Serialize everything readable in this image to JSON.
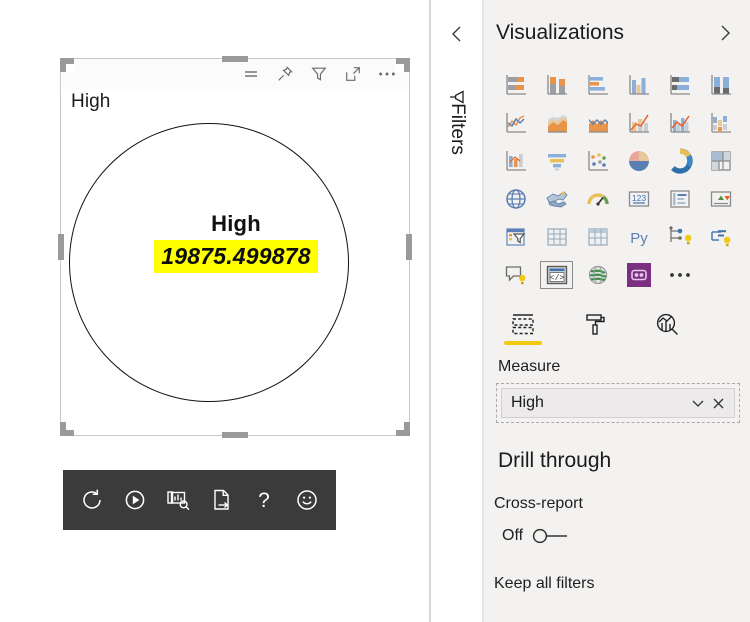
{
  "canvas": {
    "visual": {
      "title": "High",
      "category_label": "High",
      "value": "19875.499878",
      "highlight_color": "#FFFF00",
      "header_icons": [
        {
          "name": "drill-mode-icon",
          "label": "Drill mode"
        },
        {
          "name": "pin-icon",
          "label": "Pin visual"
        },
        {
          "name": "filter-icon",
          "label": "Filters"
        },
        {
          "name": "focus-mode-icon",
          "label": "Focus mode"
        },
        {
          "name": "more-options-icon",
          "label": "More options"
        }
      ]
    },
    "floating_toolbar": [
      {
        "name": "reset-icon",
        "label": "Reset"
      },
      {
        "name": "play-icon",
        "label": "Play"
      },
      {
        "name": "visual-search-icon",
        "label": "Analyze visual"
      },
      {
        "name": "export-file-icon",
        "label": "Export data"
      },
      {
        "name": "help-icon",
        "label": "Help"
      },
      {
        "name": "feedback-smiley-icon",
        "label": "Send feedback"
      }
    ]
  },
  "filters_rail": {
    "collapse_label": "Collapse",
    "title": "Filters"
  },
  "visualizations": {
    "title": "Visualizations",
    "expand_label": "Expand",
    "gallery": [
      {
        "name": "stacked-bar-chart-icon",
        "label": "Stacked bar chart"
      },
      {
        "name": "stacked-column-chart-icon",
        "label": "Stacked column chart"
      },
      {
        "name": "clustered-bar-chart-icon",
        "label": "Clustered bar chart"
      },
      {
        "name": "clustered-column-chart-icon",
        "label": "Clustered column chart"
      },
      {
        "name": "hundred-percent-stacked-bar-chart-icon",
        "label": "100% stacked bar chart"
      },
      {
        "name": "hundred-percent-stacked-column-chart-icon",
        "label": "100% stacked column chart"
      },
      {
        "name": "line-chart-icon",
        "label": "Line chart"
      },
      {
        "name": "area-chart-icon",
        "label": "Area chart"
      },
      {
        "name": "stacked-area-chart-icon",
        "label": "Stacked area chart"
      },
      {
        "name": "line-stacked-column-chart-icon",
        "label": "Line and stacked column chart"
      },
      {
        "name": "line-clustered-column-chart-icon",
        "label": "Line and clustered column chart"
      },
      {
        "name": "ribbon-waterfall-chart-icon",
        "label": "Waterfall chart"
      },
      {
        "name": "ribbon-chart-icon",
        "label": "Ribbon chart"
      },
      {
        "name": "funnel-chart-icon",
        "label": "Funnel"
      },
      {
        "name": "scatter-chart-icon",
        "label": "Scatter chart"
      },
      {
        "name": "pie-chart-icon",
        "label": "Pie chart"
      },
      {
        "name": "donut-chart-icon",
        "label": "Donut chart"
      },
      {
        "name": "treemap-icon",
        "label": "Treemap"
      },
      {
        "name": "map-icon",
        "label": "Map"
      },
      {
        "name": "filled-map-icon",
        "label": "Filled map"
      },
      {
        "name": "gauge-icon",
        "label": "Gauge"
      },
      {
        "name": "card-icon",
        "label": "Card"
      },
      {
        "name": "multi-row-card-icon",
        "label": "Multi-row card"
      },
      {
        "name": "kpi-icon",
        "label": "KPI"
      },
      {
        "name": "slicer-icon",
        "label": "Slicer"
      },
      {
        "name": "table-icon",
        "label": "Table"
      },
      {
        "name": "matrix-icon",
        "label": "Matrix"
      },
      {
        "name": "python-visual-icon",
        "label": "Py"
      },
      {
        "name": "decomposition-tree-icon",
        "label": "Decomposition tree"
      },
      {
        "name": "key-influencers-icon",
        "label": "Key influencers"
      },
      {
        "name": "qna-visual-icon",
        "label": "Q&A"
      },
      {
        "name": "custom-visual-code-icon",
        "label": "Custom visual"
      },
      {
        "name": "arcgis-maps-icon",
        "label": "ArcGIS Maps"
      },
      {
        "name": "power-apps-visual-icon",
        "label": "Power Apps"
      },
      {
        "name": "more-visuals-icon",
        "label": "More visuals"
      }
    ],
    "selected_gallery_index": 31,
    "tabs": [
      {
        "name": "tab-fields",
        "label": "Fields",
        "active": true
      },
      {
        "name": "tab-format",
        "label": "Format",
        "active": false
      },
      {
        "name": "tab-analytics",
        "label": "Analytics",
        "active": false
      }
    ],
    "field_wells": {
      "measure_label": "Measure",
      "measure_value": "High",
      "chip_dropdown_label": "Options",
      "chip_remove_label": "Remove"
    },
    "drill_through": {
      "title": "Drill through",
      "cross_report_label": "Cross-report",
      "cross_report_state": "Off",
      "keep_all_filters_label": "Keep all filters"
    }
  },
  "colors": {
    "panel_bg": "#f3f2f1",
    "accent_yellow": "#f2c811",
    "highlight": "#FFFF00",
    "toolbar_dark": "#3b3b3b",
    "power_apps_purple": "#7a2f80"
  }
}
